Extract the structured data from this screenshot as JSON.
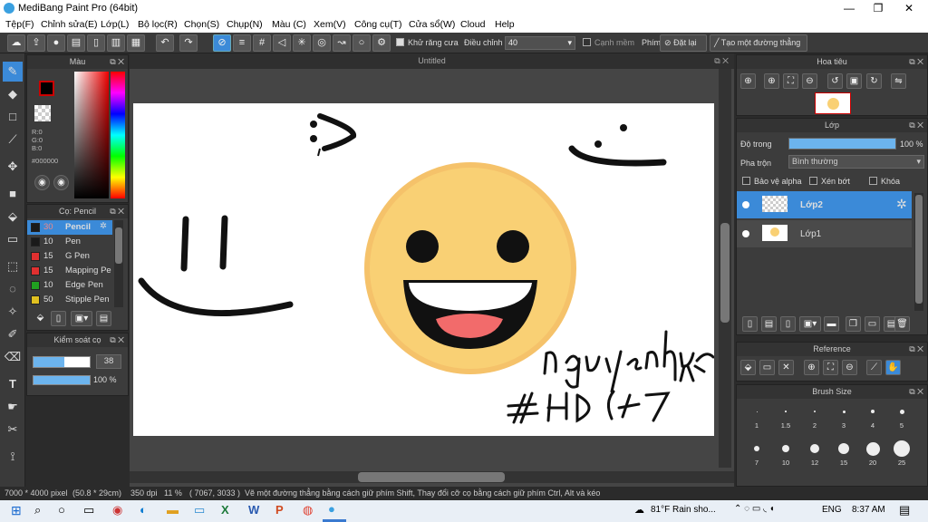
{
  "window": {
    "title": "MediBang Paint Pro (64bit)",
    "minimize": "—",
    "maximize": "❐",
    "close": "✕"
  },
  "menu": [
    "Tệp(F)",
    "Chỉnh sửa(E)",
    "Lớp(L)",
    "Bộ lọc(R)",
    "Chọn(S)",
    "Chụp(N)",
    "Màu (C)",
    "Xem(V)",
    "Công cụ(T)",
    "Cửa sổ(W)",
    "Cloud",
    "Help"
  ],
  "toolbar": {
    "antialias_label": "Khử răng cưa",
    "adjust_label": "Điều chỉnh",
    "adjust_value": "40",
    "soft_edge_label": "Cạnh mềm",
    "key_label": "Phím",
    "reset_label": "Đặt lại",
    "straight_line_label": "Tạo một đường thẳng"
  },
  "color_panel": {
    "title": "Màu",
    "r": "R:0",
    "g": "G:0",
    "b": "B:0",
    "hex": "#000000",
    "primary_color": "#000000",
    "secondary_color": "#ffffff"
  },
  "brush_panel": {
    "title": "Cọ: Pencil",
    "items": [
      {
        "size": "30",
        "name": "Pencil",
        "color": "#1a1a1a",
        "selected": true
      },
      {
        "size": "10",
        "name": "Pen",
        "color": "#1a1a1a",
        "selected": false
      },
      {
        "size": "15",
        "name": "G Pen",
        "color": "#e03030",
        "selected": false
      },
      {
        "size": "15",
        "name": "Mapping Pe",
        "color": "#e03030",
        "selected": false
      },
      {
        "size": "10",
        "name": "Edge Pen",
        "color": "#20a020",
        "selected": false
      },
      {
        "size": "50",
        "name": "Stipple Pen",
        "color": "#e0c020",
        "selected": false
      }
    ]
  },
  "brush_control": {
    "title": "Kiểm soát cọ",
    "size_value": "38",
    "opacity_value": "100 %",
    "size_fraction": 0.55,
    "opacity_fraction": 1.0
  },
  "canvas": {
    "tab_title": "Untitled"
  },
  "navigator": {
    "title": "Hoa tiêu"
  },
  "layer_panel": {
    "title": "Lớp",
    "opacity_label": "Độ trong",
    "opacity_value": "100 %",
    "opacity_fraction": 1.0,
    "blend_label": "Pha trộn",
    "blend_value": "Bình thường",
    "protect_alpha": "Bảo vệ alpha",
    "clipping": "Xén bớt",
    "lock": "Khóa",
    "layers": [
      {
        "name": "Lớp2",
        "selected": true
      },
      {
        "name": "Lớp1",
        "selected": false
      }
    ]
  },
  "reference_panel": {
    "title": "Reference"
  },
  "brush_size_panel": {
    "title": "Brush Size",
    "sizes": [
      "1",
      "1.5",
      "2",
      "3",
      "4",
      "5",
      "7",
      "10",
      "12",
      "15",
      "20",
      "25"
    ]
  },
  "status": {
    "dimensions": "7000 * 4000 pixel",
    "physical": "(50.8 * 29cm)",
    "dpi": "350 dpi",
    "zoom": "11 %",
    "coords": "( 7067, 3033 )",
    "hint": "Vẽ một đường thẳng bằng cách giữ phím Shift, Thay đổi cỡ cọ bằng cách giữ phím Ctrl, Alt và kéo"
  },
  "taskbar": {
    "weather": "81°F  Rain sho...",
    "lang": "ENG",
    "time": "8:37 AM"
  },
  "drawing": {
    "signature_text": "nguyenhue 154  # HD(47"
  }
}
